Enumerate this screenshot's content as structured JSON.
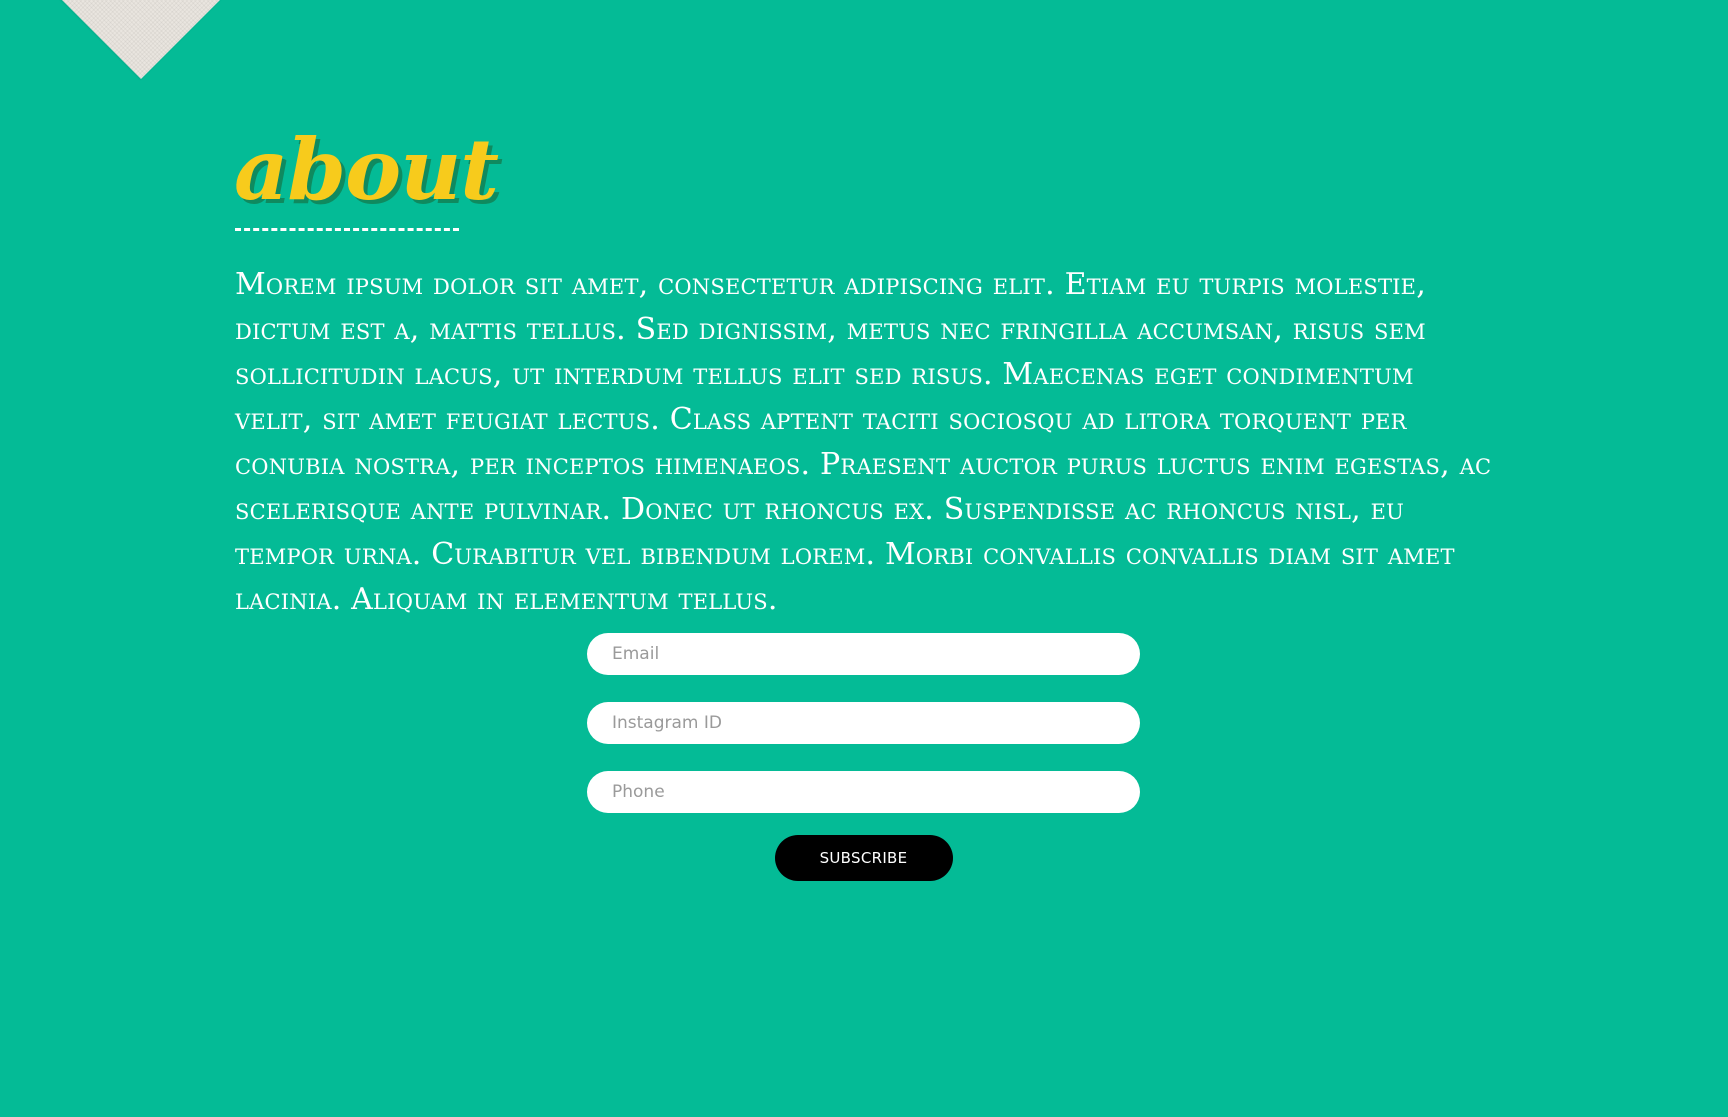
{
  "about": {
    "heading": "about",
    "text": "Morem ipsum dolor sit amet, consectetur adipiscing elit. Etiam eu turpis molestie, dictum est a, mattis tellus. Sed dignissim, metus nec fringilla accumsan, risus sem sollicitudin lacus, ut interdum tellus elit sed risus. Maecenas eget condimentum velit, sit amet feugiat lectus. Class aptent taciti sociosqu ad litora torquent per conubia nostra, per inceptos himenaeos. Praesent auctor purus luctus enim egestas, ac scelerisque ante pulvinar. Donec ut rhoncus ex. Suspendisse ac rhoncus nisl, eu tempor urna. Curabitur vel bibendum lorem. Morbi convallis convallis diam sit amet lacinia. Aliquam in elementum tellus."
  },
  "form": {
    "email_placeholder": "Email",
    "instagram_placeholder": "Instagram ID",
    "phone_placeholder": "Phone",
    "subscribe_label": "SUBSCRIBE"
  },
  "colors": {
    "background": "#04BB96",
    "heading": "#F7CB1C",
    "heading_shadow": "#0F8A5F",
    "button": "#000000"
  }
}
